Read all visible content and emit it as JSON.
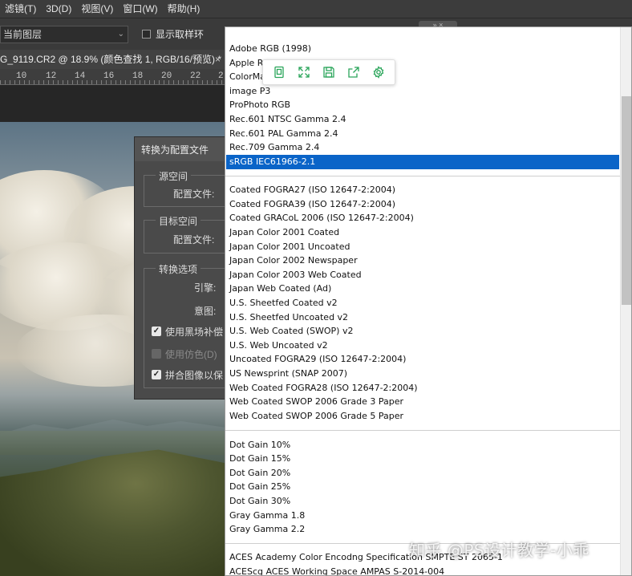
{
  "menubar": {
    "items": [
      "滤镜(T)",
      "3D(D)",
      "视图(V)",
      "窗口(W)",
      "帮助(H)"
    ]
  },
  "options_bar": {
    "sample_select": "当前图层",
    "show_sampling_ring_label": "显示取样环",
    "panel_close_glyph": "» ×"
  },
  "document_tab": {
    "title": "G_9119.CR2 @ 18.9% (颜色查找 1, RGB/16/预览) *",
    "close_glyph": "×"
  },
  "ruler": {
    "ticks": [
      "10",
      "12",
      "14",
      "16",
      "18",
      "20",
      "22",
      "2"
    ]
  },
  "convert_dialog": {
    "title": "转换为配置文件",
    "source_space_legend": "源空间",
    "source_profile_label": "配置文件:",
    "target_space_legend": "目标空间",
    "target_profile_label": "配置文件:",
    "conversion_options_legend": "转换选项",
    "engine_label": "引擎:",
    "intent_label": "意图:",
    "black_point_label": "使用黑场补偿",
    "dither_label": "使用仿色(D)",
    "flatten_label": "拼合图像以保"
  },
  "profile_list": {
    "groups": [
      [
        "Adobe RGB (1998)",
        "Apple RGB",
        "ColorMa",
        "image P3",
        "ProPhoto RGB",
        "Rec.601 NTSC Gamma 2.4",
        "Rec.601 PAL Gamma 2.4",
        "Rec.709 Gamma 2.4",
        "sRGB IEC61966-2.1"
      ],
      [
        "Coated FOGRA27 (ISO 12647-2:2004)",
        "Coated FOGRA39 (ISO 12647-2:2004)",
        "Coated GRACoL 2006 (ISO 12647-2:2004)",
        "Japan Color 2001 Coated",
        "Japan Color 2001 Uncoated",
        "Japan Color 2002 Newspaper",
        "Japan Color 2003 Web Coated",
        "Japan Web Coated (Ad)",
        "U.S. Sheetfed Coated v2",
        "U.S. Sheetfed Uncoated v2",
        "U.S. Web Coated (SWOP) v2",
        "U.S. Web Uncoated v2",
        "Uncoated FOGRA29 (ISO 12647-2:2004)",
        "US Newsprint (SNAP 2007)",
        "Web Coated FOGRA28 (ISO 12647-2:2004)",
        "Web Coated SWOP 2006 Grade 3 Paper",
        "Web Coated SWOP 2006 Grade 5 Paper"
      ],
      [
        "Dot Gain 10%",
        "Dot Gain 15%",
        "Dot Gain 20%",
        "Dot Gain 25%",
        "Dot Gain 30%",
        "Gray Gamma 1.8",
        "Gray Gamma 2.2"
      ],
      [
        "ACES Academy Color Encodng Specification SMPTE ST 2065-1",
        "ACEScg ACES Working Space AMPAS S-2014-004"
      ]
    ],
    "selected": "sRGB IEC61966-2.1"
  },
  "mini_toolbar": {
    "icons": [
      "copy-icon",
      "fullscreen-icon",
      "save-icon",
      "share-icon",
      "settings-icon"
    ]
  },
  "watermark": "知乎 @PS设计教学-小乖",
  "colors": {
    "selection": "#0a64c8",
    "toolbar_icon": "#2aa55a"
  }
}
